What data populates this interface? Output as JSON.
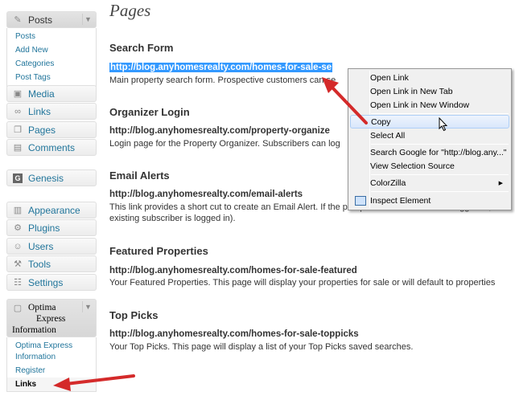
{
  "sidebar": {
    "posts": {
      "label": "Posts",
      "items": [
        "Posts",
        "Add New",
        "Categories",
        "Post Tags"
      ]
    },
    "media": "Media",
    "links": "Links",
    "pages": "Pages",
    "comments": "Comments",
    "genesis": "Genesis",
    "appearance": "Appearance",
    "plugins": "Plugins",
    "users": "Users",
    "tools": "Tools",
    "settings": "Settings",
    "optima": {
      "label_line1": "Optima",
      "label_line2": "Express",
      "label_line3": "Information",
      "items": [
        "Optima Express",
        "Information",
        "Register",
        "Links"
      ]
    }
  },
  "main": {
    "title": "Pages",
    "sections": [
      {
        "heading": "Search Form",
        "url": "http://blog.anyhomesrealty.com/homes-for-sale-se",
        "desc": "Main property search form. Prospective customers can se"
      },
      {
        "heading": "Organizer Login",
        "url": "http://blog.anyhomesrealty.com/property-organize",
        "desc": "Login page for the Property Organizer. Subscribers can log"
      },
      {
        "heading": "Email Alerts",
        "url": "http://blog.anyhomesrealty.com/email-alerts",
        "desc": "This link provides a short cut to create an Email Alert. If the prospective customer is not logged in,",
        "desc2": "existing subscriber is logged in)."
      },
      {
        "heading": "Featured Properties",
        "url": "http://blog.anyhomesrealty.com/homes-for-sale-featured",
        "desc": "Your Featured Properties. This page will display your properties for sale or will default to properties"
      },
      {
        "heading": "Top Picks",
        "url": "http://blog.anyhomesrealty.com/homes-for-sale-toppicks",
        "desc": "Your Top Picks. This page will display a list of your Top Picks saved searches."
      }
    ]
  },
  "context_menu": {
    "items": [
      "Open Link",
      "Open Link in New Tab",
      "Open Link in New Window",
      "Copy",
      "Select All",
      "Search Google for \"http://blog.any...\"",
      "View Selection Source",
      "ColorZilla",
      "Inspect Element"
    ]
  },
  "colors": {
    "selection": "#3399ff",
    "link": "#21759b",
    "arrow": "#d42a2a"
  }
}
